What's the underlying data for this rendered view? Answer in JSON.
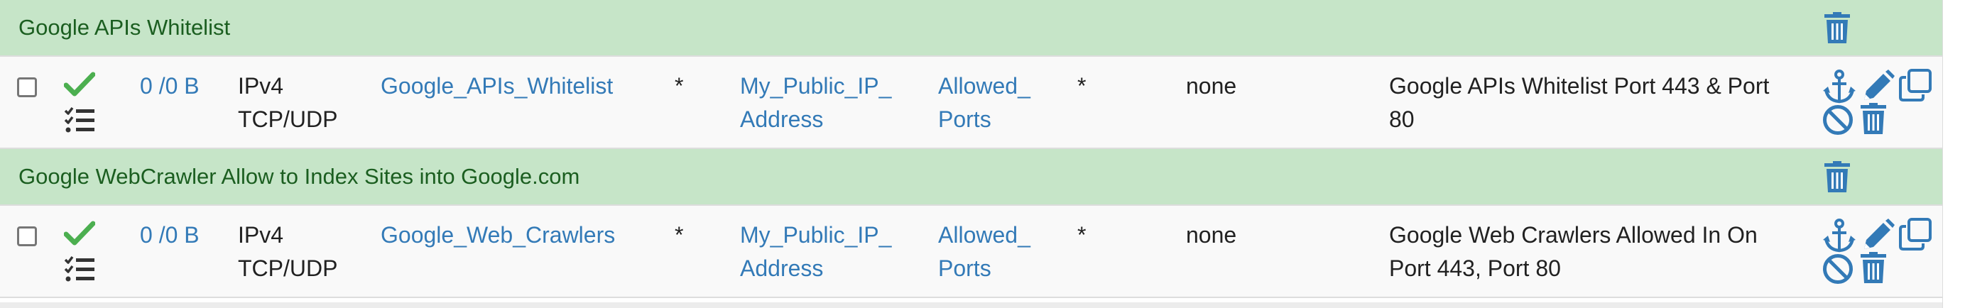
{
  "colors": {
    "separator_bg": "#c6e5c8",
    "separator_text": "#1b5e20",
    "link": "#337ab7",
    "icon_blue": "#337ab7",
    "check_green": "#4caf50"
  },
  "icons": [
    "trash-icon",
    "check-icon",
    "tasks-icon",
    "anchor-icon",
    "pencil-icon",
    "copy-icon",
    "ban-icon"
  ],
  "groups": [
    {
      "separator": "Google APIs Whitelist",
      "rule": {
        "states": "0 /0 B",
        "protocol_line1": "IPv4",
        "protocol_line2": "TCP/UDP",
        "source": "Google_APIs_Whitelist",
        "source_port": "*",
        "dest_line1": "My_Public_IP_",
        "dest_line2": "Address",
        "dest_port_line1": "Allowed_",
        "dest_port_line2": "Ports",
        "gateway": "*",
        "queue": "none",
        "desc_line1": "Google APIs Whitelist Port 443 & Port",
        "desc_line2": "80"
      }
    },
    {
      "separator": "Google WebCrawler Allow to Index Sites into Google.com",
      "rule": {
        "states": "0 /0 B",
        "protocol_line1": "IPv4",
        "protocol_line2": "TCP/UDP",
        "source": "Google_Web_Crawlers",
        "source_port": "*",
        "dest_line1": "My_Public_IP_",
        "dest_line2": "Address",
        "dest_port_line1": "Allowed_",
        "dest_port_line2": "Ports",
        "gateway": "*",
        "queue": "none",
        "desc_line1": "Google Web Crawlers Allowed In On",
        "desc_line2": "Port 443, Port 80"
      }
    }
  ]
}
